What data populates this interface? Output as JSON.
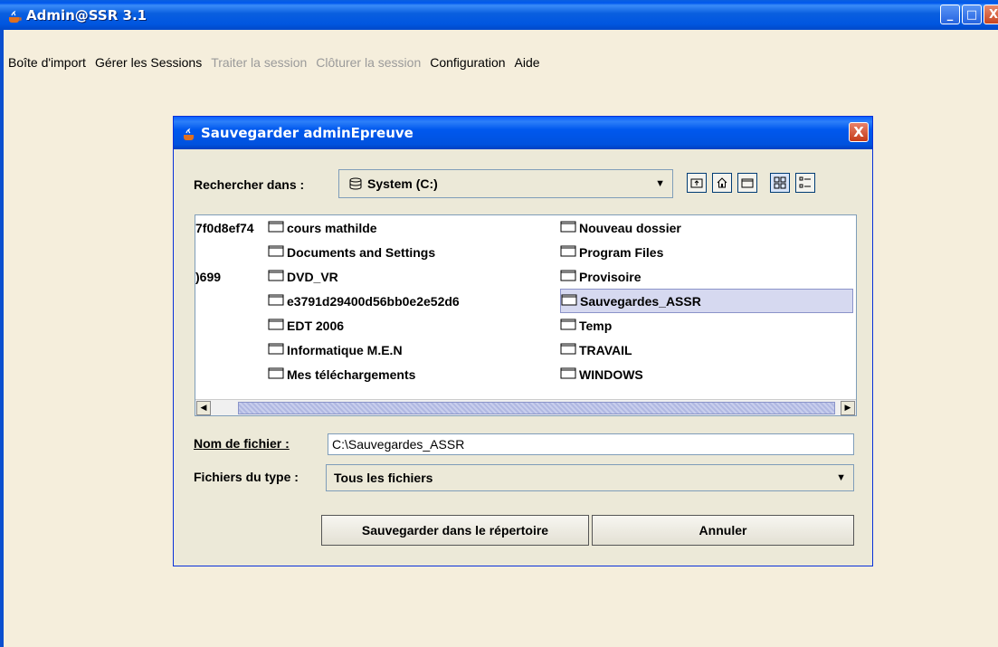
{
  "window": {
    "title": "Admin@SSR 3.1",
    "minimize": "_",
    "maximize": "□",
    "close": "X"
  },
  "menubar": {
    "items": [
      {
        "label": "Boîte d'import",
        "enabled": true
      },
      {
        "label": "Gérer les Sessions",
        "enabled": true
      },
      {
        "label": "Traiter la session",
        "enabled": false
      },
      {
        "label": "Clôturer la session",
        "enabled": false
      },
      {
        "label": "Configuration",
        "enabled": true
      },
      {
        "label": "Aide",
        "enabled": true
      }
    ]
  },
  "dialog": {
    "title": "Sauvegarder adminEpreuve",
    "close": "X",
    "lookin_label": "Rechercher dans :",
    "lookin_value": "System (C:)",
    "toolbar": [
      "up-folder-icon",
      "home-icon",
      "new-folder-icon",
      "list-view-icon",
      "details-view-icon"
    ],
    "truncated_col": [
      "7f0d8ef74",
      "",
      ")699"
    ],
    "files_col1": [
      "cours mathilde",
      "Documents and Settings",
      "DVD_VR",
      "e3791d29400d56bb0e2e52d6",
      "EDT 2006",
      "Informatique M.E.N",
      "Mes téléchargements"
    ],
    "files_col2": [
      "Nouveau dossier",
      "Program Files",
      "Provisoire",
      "Sauvegardes_ASSR",
      "Temp",
      "TRAVAIL",
      "WINDOWS"
    ],
    "selected_file": "Sauvegardes_ASSR",
    "filename_label": "Nom de fichier :",
    "filename_value": "C:\\Sauvegardes_ASSR",
    "filetype_label": "Fichiers du type :",
    "filetype_value": "Tous les fichiers",
    "save_button": "Sauvegarder dans le répertoire",
    "cancel_button": "Annuler"
  },
  "colors": {
    "titlebar": "#0058ee",
    "background": "#f5eedc",
    "dialog_bg": "#ece9d8",
    "selection": "#d6d9f0"
  }
}
